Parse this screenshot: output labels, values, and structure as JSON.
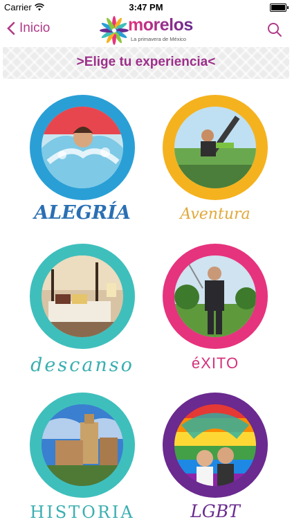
{
  "status_bar": {
    "carrier": "Carrier",
    "time": "3:47 PM"
  },
  "nav": {
    "back_label": "Inicio",
    "logo_text": "morelos",
    "logo_tagline": "La primavera de México"
  },
  "banner": {
    "title": ">Elige tu experiencia<"
  },
  "categories": [
    {
      "label": "ALEGRÍA",
      "ring_color": "#2a9fd6",
      "label_color": "#2a6fb3"
    },
    {
      "label": "Aventura",
      "ring_color": "#f5b21f",
      "label_color": "#e0a83a"
    },
    {
      "label": "descanso",
      "ring_color": "#3fbfbc",
      "label_color": "#3aaeb0"
    },
    {
      "label": "éXITO",
      "ring_color": "#e6337d",
      "label_color": "#d4317b"
    },
    {
      "label": "HISTORIA",
      "ring_color": "#3fbfbc",
      "label_color": "#3aaeb0"
    },
    {
      "label": "LGBT",
      "ring_color": "#6a2a8f",
      "label_color": "#6a2a8f"
    }
  ]
}
